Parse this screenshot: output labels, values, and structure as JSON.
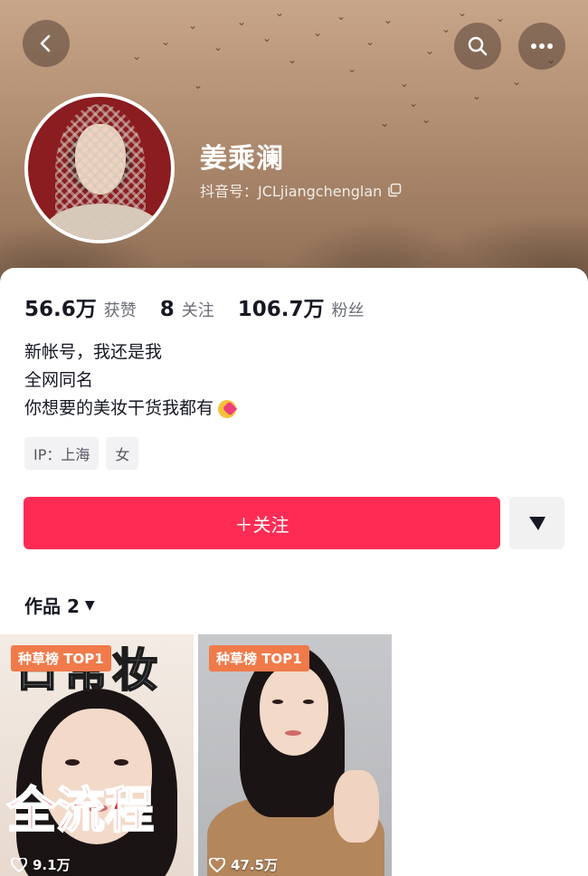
{
  "header": {
    "back_icon": "chevron-left-icon",
    "search_icon": "search-icon",
    "more_icon": "more-horizontal-icon"
  },
  "profile": {
    "name": "姜乘澜",
    "douyin_id": "抖音号：JCLjiangchenglan"
  },
  "stats": [
    {
      "value": "56.6万",
      "label": "获赞"
    },
    {
      "value": "8",
      "label": "关注"
    },
    {
      "value": "106.7万",
      "label": "粉丝"
    }
  ],
  "bio": {
    "line1": "新帐号，我还是我",
    "line2": "全网同名",
    "line3": "你想要的美妆干货我都有"
  },
  "tags": {
    "ip": "IP：上海",
    "gender": "女"
  },
  "actions": {
    "follow_label": "＋关注",
    "more_icon": "triangle-down-icon"
  },
  "works": {
    "tab_label": "作品 2",
    "arrow": "▼",
    "items": [
      {
        "badge": "种草榜 TOP1",
        "title_top": "日常妆",
        "title_bottom": "全流程",
        "likes": "9.1万"
      },
      {
        "badge": "种草榜 TOP1",
        "likes": "47.5万"
      }
    ]
  },
  "colors": {
    "accent": "#fe2c55",
    "badge": "#f07a4a"
  }
}
